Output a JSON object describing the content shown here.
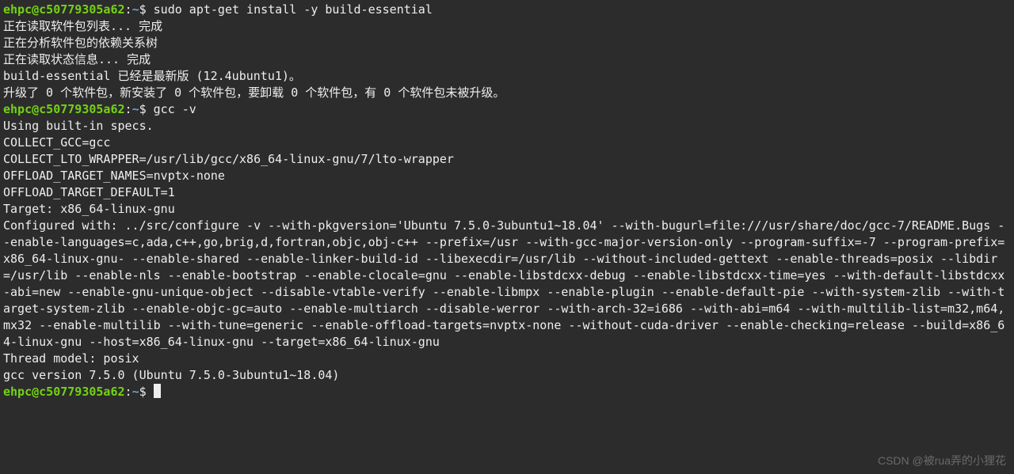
{
  "prompt": {
    "user_host": "ehpc@c50779305a62",
    "sep": ":",
    "path": "~",
    "dollar": "$"
  },
  "commands": {
    "cmd1": " sudo apt-get install -y build-essential",
    "cmd2": " gcc -v",
    "cmd3": " "
  },
  "apt_output": {
    "line1": "正在读取软件包列表... 完成",
    "line2": "正在分析软件包的依赖关系树",
    "line3": "正在读取状态信息... 完成",
    "line4": "build-essential 已经是最新版 (12.4ubuntu1)。",
    "line5": "升级了 0 个软件包，新安装了 0 个软件包，要卸载 0 个软件包，有 0 个软件包未被升级。"
  },
  "gcc_output": {
    "l1": "Using built-in specs.",
    "l2": "COLLECT_GCC=gcc",
    "l3": "COLLECT_LTO_WRAPPER=/usr/lib/gcc/x86_64-linux-gnu/7/lto-wrapper",
    "l4": "OFFLOAD_TARGET_NAMES=nvptx-none",
    "l5": "OFFLOAD_TARGET_DEFAULT=1",
    "l6": "Target: x86_64-linux-gnu",
    "conf": "Configured with: ../src/configure -v --with-pkgversion='Ubuntu 7.5.0-3ubuntu1~18.04' --with-bugurl=file:///usr/share/doc/gcc-7/README.Bugs --enable-languages=c,ada,c++,go,brig,d,fortran,objc,obj-c++ --prefix=/usr --with-gcc-major-version-only --program-suffix=-7 --program-prefix=x86_64-linux-gnu- --enable-shared --enable-linker-build-id --libexecdir=/usr/lib --without-included-gettext --enable-threads=posix --libdir=/usr/lib --enable-nls --enable-bootstrap --enable-clocale=gnu --enable-libstdcxx-debug --enable-libstdcxx-time=yes --with-default-libstdcxx-abi=new --enable-gnu-unique-object --disable-vtable-verify --enable-libmpx --enable-plugin --enable-default-pie --with-system-zlib --with-target-system-zlib --enable-objc-gc=auto --enable-multiarch --disable-werror --with-arch-32=i686 --with-abi=m64 --with-multilib-list=m32,m64,mx32 --enable-multilib --with-tune=generic --enable-offload-targets=nvptx-none --without-cuda-driver --enable-checking=release --build=x86_64-linux-gnu --host=x86_64-linux-gnu --target=x86_64-linux-gnu",
    "l8": "Thread model: posix",
    "l9": "gcc version 7.5.0 (Ubuntu 7.5.0-3ubuntu1~18.04)"
  },
  "watermark": "CSDN @被rua弄的小狸花"
}
